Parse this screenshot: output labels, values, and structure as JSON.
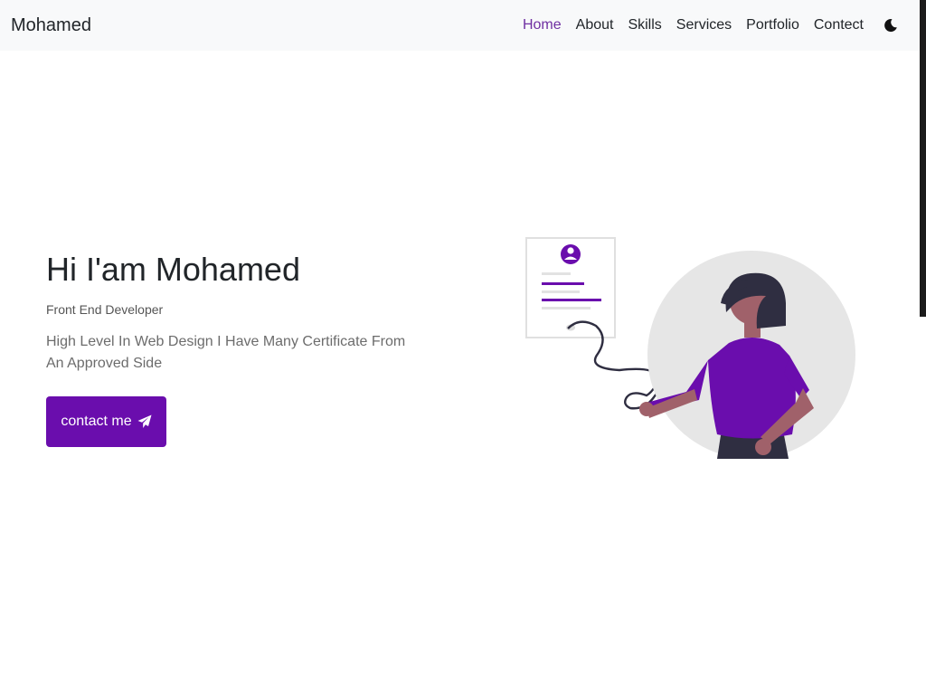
{
  "navbar": {
    "brand": "Mohamed",
    "links": [
      {
        "label": "Home",
        "active": true
      },
      {
        "label": "About"
      },
      {
        "label": "Skills"
      },
      {
        "label": "Services"
      },
      {
        "label": "Portfolio"
      },
      {
        "label": "Contect"
      }
    ],
    "theme_icon": "moon-icon"
  },
  "hero": {
    "title": "Hi I'am Mohamed",
    "role": "Front End Developer",
    "description": "High Level In Web Design I Have Many Certificate From An Approved Side",
    "button_label": "contact me",
    "button_icon": "paper-plane-icon",
    "illustration": "woman-with-resume-illustration"
  },
  "colors": {
    "accent": "#6a0dad",
    "active_link": "#6f2fa2",
    "navbar_bg": "#f8f9fa",
    "circle": "#e6e6e6",
    "skin": "#a0616a",
    "hair": "#2f2e41"
  }
}
